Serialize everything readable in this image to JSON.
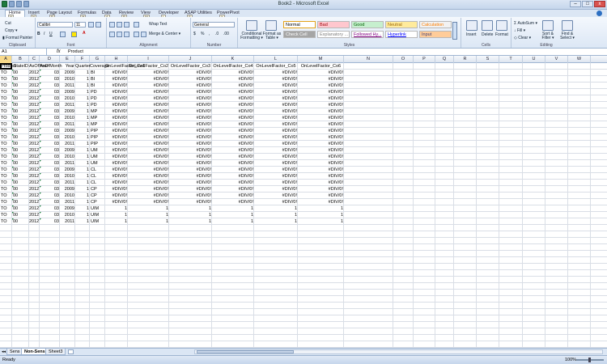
{
  "window": {
    "title": "Book2 - Microsoft Excel",
    "minimize": "–",
    "maximize": "□",
    "close": "x"
  },
  "ribbon": {
    "tabs": [
      {
        "label": "Home",
        "key": "H"
      },
      {
        "label": "Insert",
        "key": "N"
      },
      {
        "label": "Page Layout",
        "key": "P"
      },
      {
        "label": "Formulas",
        "key": "M"
      },
      {
        "label": "Data",
        "key": "A"
      },
      {
        "label": "Review",
        "key": "R"
      },
      {
        "label": "View",
        "key": "W"
      },
      {
        "label": "Developer",
        "key": "L"
      },
      {
        "label": "ASAP Utilities",
        "key": "S"
      },
      {
        "label": "PowerPivot",
        "key": "Y"
      }
    ],
    "clipboard": {
      "cut": "Cut",
      "copy": "Copy ▾",
      "format_painter": "Format Painter",
      "label": "Clipboard"
    },
    "font": {
      "name": "Calibri",
      "size": "11",
      "label": "Font"
    },
    "alignment": {
      "wrap_text": "Wrap Text",
      "merge": "Merge & Center ▾",
      "label": "Alignment"
    },
    "number": {
      "format": "General",
      "label": "Number"
    },
    "styles": {
      "conditional": "Conditional Formatting ▾",
      "format_table": "Format as Table ▾",
      "label": "Styles",
      "cells": [
        {
          "label": "Normal",
          "bg": "#ffffff",
          "color": "#000000"
        },
        {
          "label": "Bad",
          "bg": "#ffc7ce",
          "color": "#9c0006"
        },
        {
          "label": "Good",
          "bg": "#c6efce",
          "color": "#006100"
        },
        {
          "label": "Neutral",
          "bg": "#ffeb9c",
          "color": "#9c6500"
        },
        {
          "label": "Calculation",
          "bg": "#f2f2f2",
          "color": "#fa7d00"
        },
        {
          "label": "Check Cell",
          "bg": "#a5a5a5",
          "color": "#ffffff"
        },
        {
          "label": "Explanatory ...",
          "bg": "#ffffff",
          "color": "#7f7f7f"
        },
        {
          "label": "Followed Hy...",
          "bg": "#ffffff",
          "color": "#800080"
        },
        {
          "label": "Hyperlink",
          "bg": "#ffffff",
          "color": "#0000ff"
        },
        {
          "label": "Input",
          "bg": "#ffcc99",
          "color": "#3f3f76"
        }
      ]
    },
    "cells": {
      "insert": "Insert",
      "delete": "Delete",
      "format": "Format",
      "label": "Cells"
    },
    "editing": {
      "autosum": "AutoSum ▾",
      "fill": "Fill ▾",
      "clear": "Clear ▾",
      "sort": "Sort & Filter ▾",
      "find": "Find & Select ▾",
      "label": "Editing"
    }
  },
  "formula_bar": {
    "name_box": "A1",
    "fx": "fx",
    "content": "Product"
  },
  "columns": [
    "A",
    "B",
    "C",
    "D",
    "E",
    "F",
    "G",
    "H",
    "I",
    "J",
    "K",
    "L",
    "M",
    "N",
    "O",
    "P",
    "Q",
    "R",
    "S",
    "T",
    "U",
    "V",
    "W"
  ],
  "headers": [
    "Product",
    "StateID",
    "AsOfYear",
    "AsOfMonth",
    "Year",
    "Quarter",
    "Coverage",
    "OnLevelFactor_Co1",
    "OnLevelFactor_Co2",
    "OnLevelFactor_Co3",
    "OnLevelFactor_Co4",
    "OnLevelFactor_Co5",
    "OnLevelFactor_Co6"
  ],
  "rows": [
    [
      "TO",
      "00",
      "2012",
      "03",
      "2009",
      "1",
      "BI",
      "#DIV/0!",
      "#DIV/0!",
      "#DIV/0!",
      "#DIV/0!",
      "#DIV/0!",
      "#DIV/0!"
    ],
    [
      "TO",
      "00",
      "2012",
      "03",
      "2010",
      "1",
      "BI",
      "#DIV/0!",
      "#DIV/0!",
      "#DIV/0!",
      "#DIV/0!",
      "#DIV/0!",
      "#DIV/0!"
    ],
    [
      "TO",
      "00",
      "2012",
      "03",
      "2011",
      "1",
      "BI",
      "#DIV/0!",
      "#DIV/0!",
      "#DIV/0!",
      "#DIV/0!",
      "#DIV/0!",
      "#DIV/0!"
    ],
    [
      "TO",
      "00",
      "2012",
      "03",
      "2009",
      "1",
      "PD",
      "#DIV/0!",
      "#DIV/0!",
      "#DIV/0!",
      "#DIV/0!",
      "#DIV/0!",
      "#DIV/0!"
    ],
    [
      "TO",
      "00",
      "2012",
      "03",
      "2010",
      "1",
      "PD",
      "#DIV/0!",
      "#DIV/0!",
      "#DIV/0!",
      "#DIV/0!",
      "#DIV/0!",
      "#DIV/0!"
    ],
    [
      "TO",
      "00",
      "2012",
      "03",
      "2011",
      "1",
      "PD",
      "#DIV/0!",
      "#DIV/0!",
      "#DIV/0!",
      "#DIV/0!",
      "#DIV/0!",
      "#DIV/0!"
    ],
    [
      "TO",
      "00",
      "2012",
      "03",
      "2009",
      "1",
      "MP",
      "#DIV/0!",
      "#DIV/0!",
      "#DIV/0!",
      "#DIV/0!",
      "#DIV/0!",
      "#DIV/0!"
    ],
    [
      "TO",
      "00",
      "2012",
      "03",
      "2010",
      "1",
      "MP",
      "#DIV/0!",
      "#DIV/0!",
      "#DIV/0!",
      "#DIV/0!",
      "#DIV/0!",
      "#DIV/0!"
    ],
    [
      "TO",
      "00",
      "2012",
      "03",
      "2011",
      "1",
      "MP",
      "#DIV/0!",
      "#DIV/0!",
      "#DIV/0!",
      "#DIV/0!",
      "#DIV/0!",
      "#DIV/0!"
    ],
    [
      "TO",
      "00",
      "2012",
      "03",
      "2009",
      "1",
      "PIP",
      "#DIV/0!",
      "#DIV/0!",
      "#DIV/0!",
      "#DIV/0!",
      "#DIV/0!",
      "#DIV/0!"
    ],
    [
      "TO",
      "00",
      "2012",
      "03",
      "2010",
      "1",
      "PIP",
      "#DIV/0!",
      "#DIV/0!",
      "#DIV/0!",
      "#DIV/0!",
      "#DIV/0!",
      "#DIV/0!"
    ],
    [
      "TO",
      "00",
      "2012",
      "03",
      "2011",
      "1",
      "PIP",
      "#DIV/0!",
      "#DIV/0!",
      "#DIV/0!",
      "#DIV/0!",
      "#DIV/0!",
      "#DIV/0!"
    ],
    [
      "TO",
      "00",
      "2012",
      "03",
      "2009",
      "1",
      "UM",
      "#DIV/0!",
      "#DIV/0!",
      "#DIV/0!",
      "#DIV/0!",
      "#DIV/0!",
      "#DIV/0!"
    ],
    [
      "TO",
      "00",
      "2012",
      "03",
      "2010",
      "1",
      "UM",
      "#DIV/0!",
      "#DIV/0!",
      "#DIV/0!",
      "#DIV/0!",
      "#DIV/0!",
      "#DIV/0!"
    ],
    [
      "TO",
      "00",
      "2012",
      "03",
      "2011",
      "1",
      "UM",
      "#DIV/0!",
      "#DIV/0!",
      "#DIV/0!",
      "#DIV/0!",
      "#DIV/0!",
      "#DIV/0!"
    ],
    [
      "TO",
      "00",
      "2012",
      "03",
      "2009",
      "1",
      "CL",
      "#DIV/0!",
      "#DIV/0!",
      "#DIV/0!",
      "#DIV/0!",
      "#DIV/0!",
      "#DIV/0!"
    ],
    [
      "TO",
      "00",
      "2012",
      "03",
      "2010",
      "1",
      "CL",
      "#DIV/0!",
      "#DIV/0!",
      "#DIV/0!",
      "#DIV/0!",
      "#DIV/0!",
      "#DIV/0!"
    ],
    [
      "TO",
      "00",
      "2012",
      "03",
      "2011",
      "1",
      "CL",
      "#DIV/0!",
      "#DIV/0!",
      "#DIV/0!",
      "#DIV/0!",
      "#DIV/0!",
      "#DIV/0!"
    ],
    [
      "TO",
      "00",
      "2012",
      "03",
      "2009",
      "1",
      "CP",
      "#DIV/0!",
      "#DIV/0!",
      "#DIV/0!",
      "#DIV/0!",
      "#DIV/0!",
      "#DIV/0!"
    ],
    [
      "TO",
      "00",
      "2012",
      "03",
      "2010",
      "1",
      "CP",
      "#DIV/0!",
      "#DIV/0!",
      "#DIV/0!",
      "#DIV/0!",
      "#DIV/0!",
      "#DIV/0!"
    ],
    [
      "TO",
      "00",
      "2012",
      "03",
      "2011",
      "1",
      "CP",
      "#DIV/0!",
      "#DIV/0!",
      "#DIV/0!",
      "#DIV/0!",
      "#DIV/0!",
      "#DIV/0!"
    ],
    [
      "TO",
      "00",
      "2012",
      "03",
      "2009",
      "1",
      "UIM",
      "1",
      "1",
      "1",
      "1",
      "1",
      "1"
    ],
    [
      "TO",
      "00",
      "2012",
      "03",
      "2010",
      "1",
      "UIM",
      "1",
      "1",
      "1",
      "1",
      "1",
      "1"
    ],
    [
      "TO",
      "00",
      "2012",
      "03",
      "2011",
      "1",
      "UIM",
      "1",
      "1",
      "1",
      "1",
      "1",
      "1"
    ]
  ],
  "sheets": [
    {
      "label": "Sens",
      "active": false
    },
    {
      "label": "Non-Sens",
      "active": true
    },
    {
      "label": "Sheet3",
      "active": false
    }
  ],
  "status": {
    "ready": "Ready",
    "zoom": "100%"
  }
}
